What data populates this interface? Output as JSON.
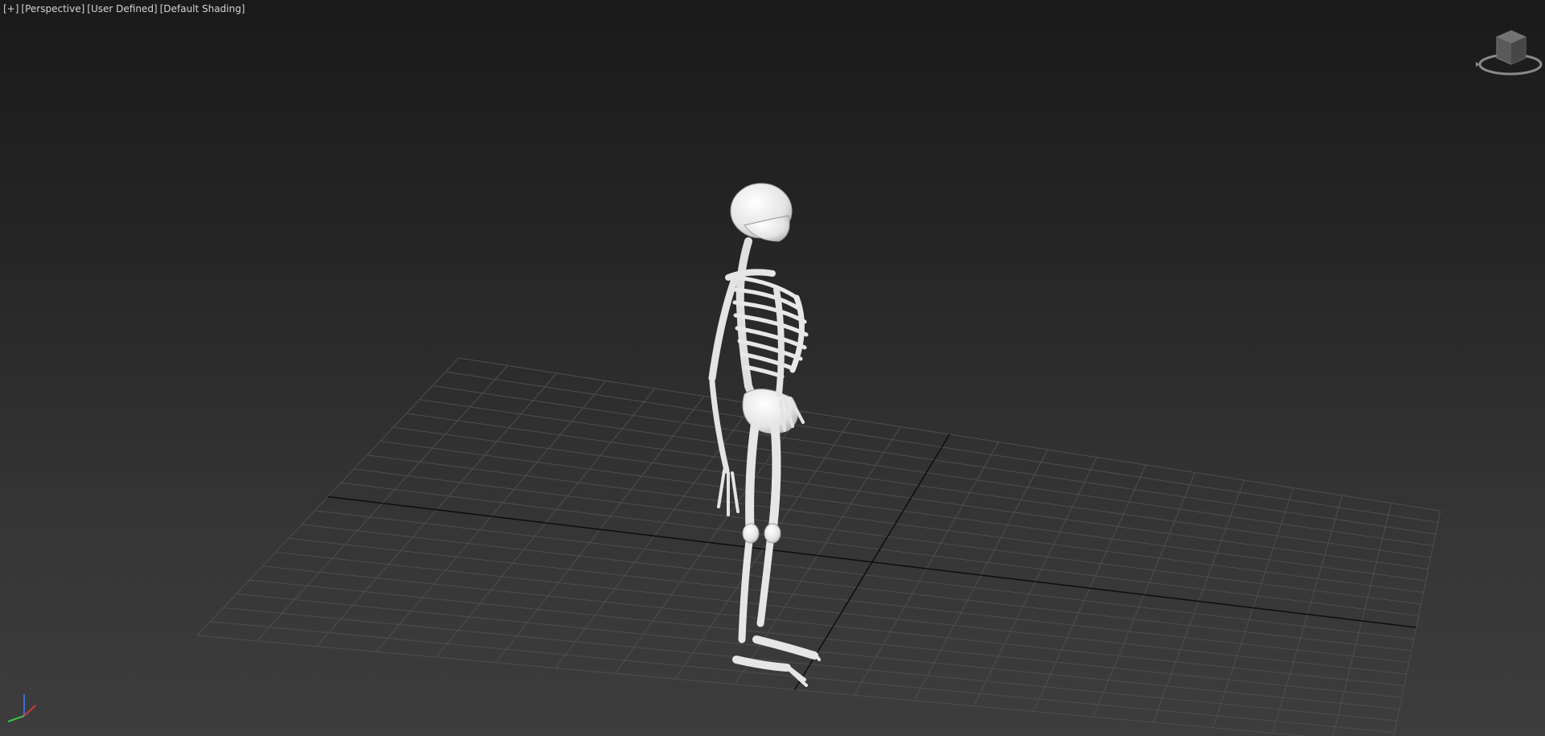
{
  "viewport": {
    "labels": {
      "plus": "[+]",
      "view": "[Perspective]",
      "camera": "[User Defined]",
      "shading": "[Default Shading]"
    }
  },
  "viewcube": {
    "icon": "viewcube-icon"
  },
  "axis_gizmo": {
    "icon": "axis-tripod-icon",
    "x_color": "#d23b3b",
    "y_color": "#3bbf4a",
    "z_color": "#3b6bd2"
  },
  "scene": {
    "object": "skeleton-model",
    "grid_color": "#4e4e4e",
    "axis_line_color": "#0d0d0d",
    "bone_color": "#e6e6e6"
  }
}
